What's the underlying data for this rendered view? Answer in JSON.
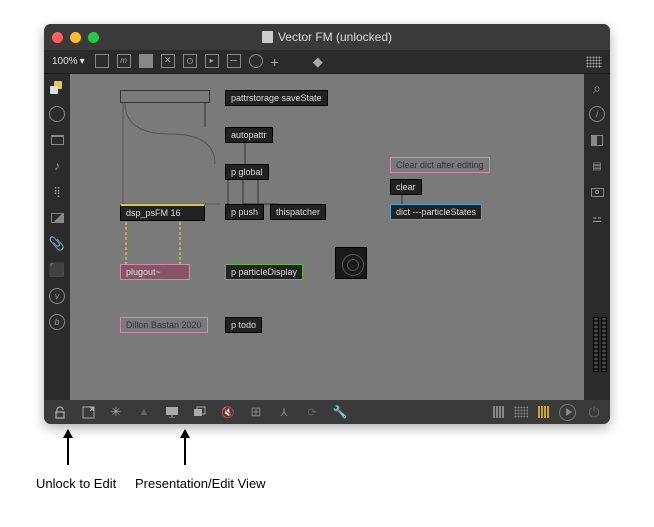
{
  "window": {
    "title": "Vector FM (unlocked)"
  },
  "toolbar": {
    "zoom": "100%"
  },
  "objects": {
    "pattrstorage": "pattrstorage saveState",
    "autopattr": "autopattr",
    "p_global": "p global",
    "dsp": "dsp_psFM 16",
    "p_push": "p push",
    "thispatcher": "thispatcher",
    "clear": "clear",
    "dict": "dict ---particleStates",
    "plugout": "plugout~",
    "p_particledisplay": "p particleDisplay",
    "p_todo": "p todo"
  },
  "comments": {
    "clear_dict": "Clear dict after editing",
    "credit": "Dillon Bastan 2020"
  },
  "annotations": {
    "unlock": "Unlock to Edit",
    "presentation": "Presentation/Edit View"
  }
}
